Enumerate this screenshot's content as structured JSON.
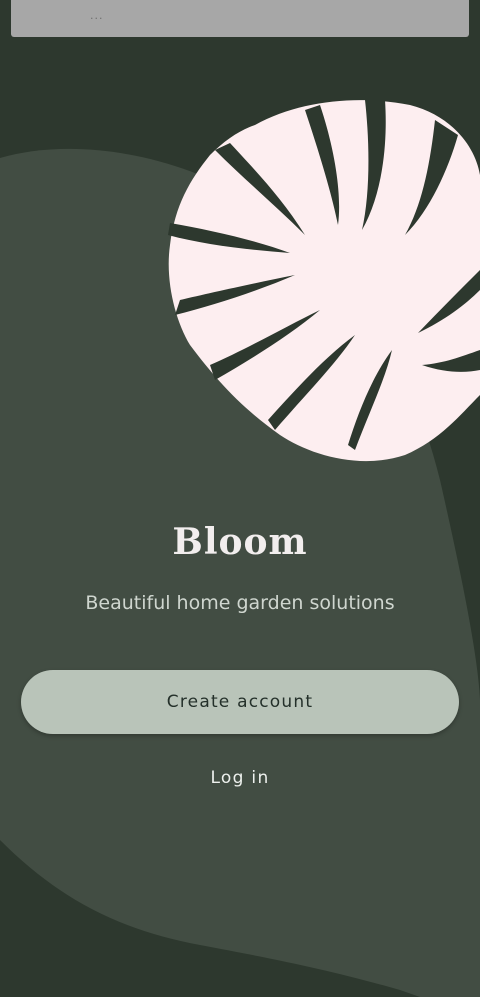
{
  "status_bar": {
    "dots": "..."
  },
  "brand": {
    "title": "Bloom",
    "subtitle": "Beautiful home garden solutions"
  },
  "actions": {
    "create_account_label": "Create account",
    "login_label": "Log in"
  },
  "colors": {
    "background_dark": "#2d382e",
    "background_panel": "#424d43",
    "leaf": "#fdeef0",
    "primary_button": "#b9c4b9",
    "primary_button_text": "#24302a",
    "text_light": "#f2eeee"
  },
  "icons": {
    "hero_illustration": "monstera-leaf"
  }
}
